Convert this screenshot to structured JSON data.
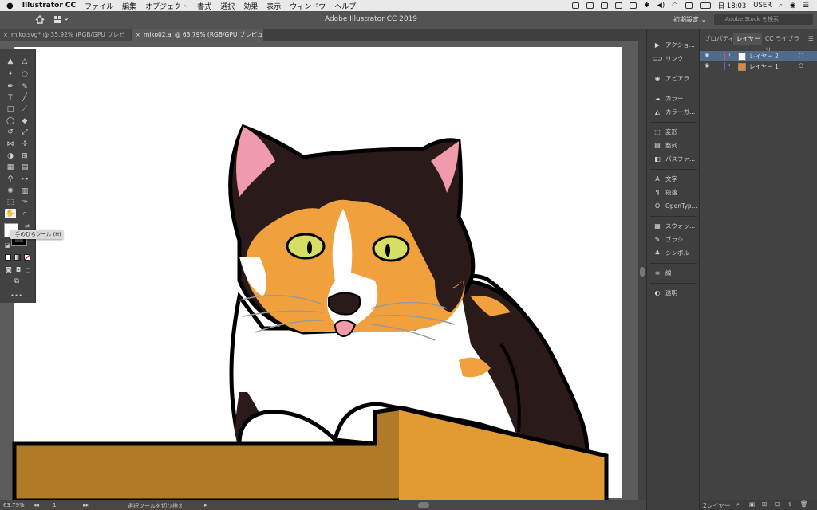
{
  "menubar": {
    "apple": "",
    "app_name": "Illustrator CC",
    "menus": [
      "ファイル",
      "編集",
      "オブジェクト",
      "書式",
      "選択",
      "効果",
      "表示",
      "ウィンドウ",
      "ヘルプ"
    ],
    "clock": "日 18:03",
    "user": "USER"
  },
  "titlebar": {
    "title": "Adobe Illustrator CC 2019",
    "preset": "初期設定 ⌄",
    "stock_placeholder": "Adobe Stock を検索"
  },
  "tabs": [
    {
      "label": "miko.svg* @ 35.92% (RGB/GPU プレビュー)",
      "close": "×"
    },
    {
      "label": "miko02.ai @ 63.79% (RGB/GPU プレビュー)",
      "close": "×"
    }
  ],
  "toolbar": {
    "tooltip": "手のひらツール (H)",
    "more": "•••",
    "fill_color": "#ffffff",
    "stroke_color": "#000000"
  },
  "status": {
    "zoom": "63.79%",
    "page": "1",
    "tool_hint": "選択ツールを切り換え"
  },
  "mid_panel": {
    "groups": [
      [
        {
          "icon": "play-icon",
          "label": "アクショ..."
        },
        {
          "icon": "link-icon",
          "label": "リンク"
        }
      ],
      [
        {
          "icon": "appearance-icon",
          "label": "アピアラ..."
        }
      ],
      [
        {
          "icon": "color-icon",
          "label": "カラー"
        },
        {
          "icon": "color-guide-icon",
          "label": "カラーガ..."
        }
      ],
      [
        {
          "icon": "transform-icon",
          "label": "変形"
        },
        {
          "icon": "align-icon",
          "label": "整列"
        },
        {
          "icon": "pathfinder-icon",
          "label": "パスファ..."
        }
      ],
      [
        {
          "icon": "character-icon",
          "label": "文字"
        },
        {
          "icon": "paragraph-icon",
          "label": "段落"
        },
        {
          "icon": "opentype-icon",
          "label": "OpenTyp..."
        }
      ],
      [
        {
          "icon": "swatches-icon",
          "label": "スウォッ..."
        },
        {
          "icon": "brush-icon",
          "label": "ブラシ"
        },
        {
          "icon": "symbol-icon",
          "label": "シンボル"
        }
      ],
      [
        {
          "icon": "stroke-icon",
          "label": "線"
        }
      ],
      [
        {
          "icon": "transparency-icon",
          "label": "透明"
        }
      ]
    ]
  },
  "right_panel": {
    "tabs": [
      "プロパティ",
      "レイヤー",
      "CC ライブラリ"
    ],
    "active_tab": 1,
    "layers": [
      {
        "name": "レイヤー 2",
        "color": "#e34d4d",
        "active": true
      },
      {
        "name": "レイヤー 1",
        "color": "#4a6fe0",
        "active": false
      }
    ],
    "layer_count": "2レイヤー"
  },
  "colors": {
    "cat_orange": "#f0a03c",
    "cat_dark": "#2a1a1a",
    "ear_pink": "#ef9bab",
    "eye_green": "#d6df63",
    "box_front": "#b07a26",
    "box_top": "#e29a33",
    "canvas_bg": "#5c5c5c"
  }
}
